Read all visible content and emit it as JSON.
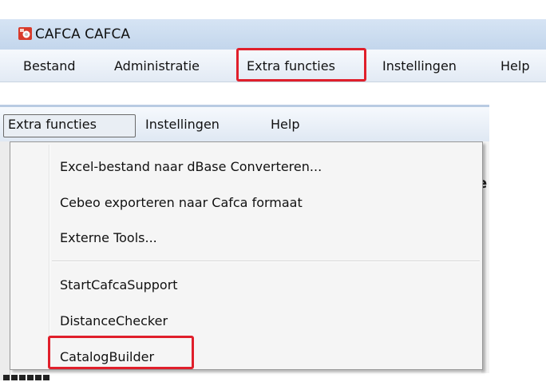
{
  "window": {
    "title": "CAFCA CAFCA",
    "icon": "cafca-app-icon",
    "menu": [
      "Bestand",
      "Administratie",
      "Extra functies",
      "Instellingen",
      "Help"
    ]
  },
  "submenu_view": {
    "menu": [
      "Extra functies",
      "Instellingen",
      "Help"
    ],
    "active_menu": "Extra functies",
    "dropdown": {
      "group1": [
        "Excel-bestand naar dBase Converteren...",
        "Cebeo exporteren naar Cafca formaat",
        "Externe Tools..."
      ],
      "group2": [
        "StartCafcaSupport",
        "DistanceChecker",
        "CatalogBuilder"
      ]
    },
    "background_fragment": "e"
  },
  "highlights": {
    "color": "#e01f2b",
    "targets": [
      "Extra functies",
      "CatalogBuilder"
    ]
  }
}
